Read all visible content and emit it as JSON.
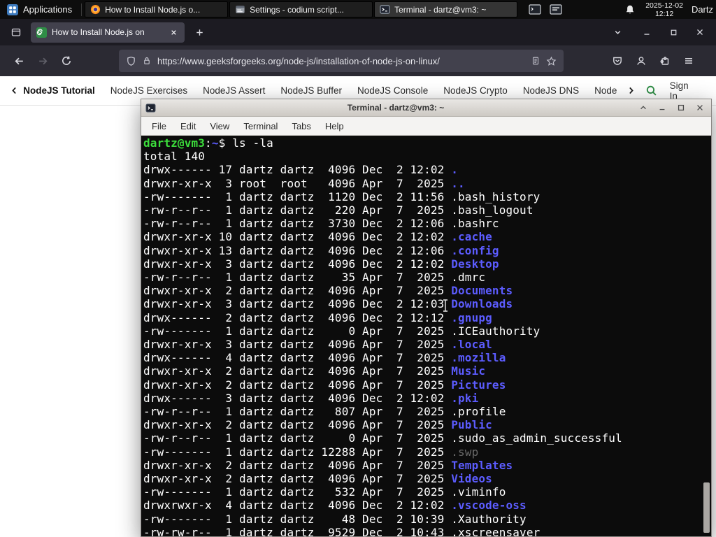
{
  "panel": {
    "applications_label": "Applications",
    "tasks": [
      {
        "label": "How to Install Node.js o...",
        "icon": "firefox-icon"
      },
      {
        "label": "Settings - codium script...",
        "icon": "settings-icon"
      },
      {
        "label": "Terminal - dartz@vm3: ~",
        "icon": "terminal-icon"
      }
    ],
    "tray_icons": [
      "vm-window-icon",
      "terminal-window-icon"
    ],
    "clock": {
      "date": "2025-12-02",
      "time": "12:12"
    },
    "user": "Dartz"
  },
  "browser": {
    "tab": {
      "title": "How to Install Node.js on"
    },
    "url": "https://www.geeksforgeeks.org/node-js/installation-of-node-js-on-linux/",
    "accent_green": "#2f8d46",
    "site_nav": {
      "items": [
        "NodeJS Tutorial",
        "NodeJS Exercises",
        "NodeJS Assert",
        "NodeJS Buffer",
        "NodeJS Console",
        "NodeJS Crypto",
        "NodeJS DNS",
        "Node"
      ],
      "sign_in_label": "Sign In"
    },
    "icons": [
      "firefox-view-icon",
      "site-favicon",
      "close-icon",
      "new-tab-icon",
      "list-tabs-chevron-icon",
      "minimize-icon",
      "maximize-icon",
      "back-icon",
      "forward-icon",
      "reload-icon",
      "shield-icon",
      "lock-icon",
      "reader-view-icon",
      "bookmark-star-icon",
      "pocket-icon",
      "account-icon",
      "extensions-icon",
      "menu-icon",
      "search-icon",
      "chevron-left-icon",
      "chevron-right-icon"
    ]
  },
  "terminal": {
    "title": "Terminal - dartz@vm3: ~",
    "menu_items": [
      "File",
      "Edit",
      "View",
      "Terminal",
      "Tabs",
      "Help"
    ],
    "prompt": {
      "user_host": "dartz@vm3",
      "colon": ":",
      "path": "~",
      "suffix": "$ ",
      "command": "ls -la"
    },
    "total_line": "total 140",
    "colors": {
      "background": "#0c0c0c",
      "foreground": "#ffffff",
      "directory": "#5c5cff",
      "prompt": "#3cdd3c",
      "dim": "#6a6a6a"
    },
    "listing": [
      {
        "meta": "drwx------ 17 dartz dartz  4096 Dec  2 12:02 ",
        "name": ".",
        "type": "dir"
      },
      {
        "meta": "drwxr-xr-x  3 root  root   4096 Apr  7  2025 ",
        "name": "..",
        "type": "dir"
      },
      {
        "meta": "-rw-------  1 dartz dartz  1120 Dec  2 11:56 ",
        "name": ".bash_history",
        "type": "file"
      },
      {
        "meta": "-rw-r--r--  1 dartz dartz   220 Apr  7  2025 ",
        "name": ".bash_logout",
        "type": "file"
      },
      {
        "meta": "-rw-r--r--  1 dartz dartz  3730 Dec  2 12:06 ",
        "name": ".bashrc",
        "type": "file"
      },
      {
        "meta": "drwxr-xr-x 10 dartz dartz  4096 Dec  2 12:02 ",
        "name": ".cache",
        "type": "dir"
      },
      {
        "meta": "drwxr-xr-x 13 dartz dartz  4096 Dec  2 12:06 ",
        "name": ".config",
        "type": "dir"
      },
      {
        "meta": "drwxr-xr-x  3 dartz dartz  4096 Dec  2 12:02 ",
        "name": "Desktop",
        "type": "dir"
      },
      {
        "meta": "-rw-r--r--  1 dartz dartz    35 Apr  7  2025 ",
        "name": ".dmrc",
        "type": "file"
      },
      {
        "meta": "drwxr-xr-x  2 dartz dartz  4096 Apr  7  2025 ",
        "name": "Documents",
        "type": "dir"
      },
      {
        "meta": "drwxr-xr-x  3 dartz dartz  4096 Dec  2 12:03 ",
        "name": "Downloads",
        "type": "dir"
      },
      {
        "meta": "drwx------  2 dartz dartz  4096 Dec  2 12:12 ",
        "name": ".gnupg",
        "type": "dir"
      },
      {
        "meta": "-rw-------  1 dartz dartz     0 Apr  7  2025 ",
        "name": ".ICEauthority",
        "type": "file"
      },
      {
        "meta": "drwxr-xr-x  3 dartz dartz  4096 Apr  7  2025 ",
        "name": ".local",
        "type": "dir"
      },
      {
        "meta": "drwx------  4 dartz dartz  4096 Apr  7  2025 ",
        "name": ".mozilla",
        "type": "dir"
      },
      {
        "meta": "drwxr-xr-x  2 dartz dartz  4096 Apr  7  2025 ",
        "name": "Music",
        "type": "dir"
      },
      {
        "meta": "drwxr-xr-x  2 dartz dartz  4096 Apr  7  2025 ",
        "name": "Pictures",
        "type": "dir"
      },
      {
        "meta": "drwx------  3 dartz dartz  4096 Dec  2 12:02 ",
        "name": ".pki",
        "type": "dir"
      },
      {
        "meta": "-rw-r--r--  1 dartz dartz   807 Apr  7  2025 ",
        "name": ".profile",
        "type": "file"
      },
      {
        "meta": "drwxr-xr-x  2 dartz dartz  4096 Apr  7  2025 ",
        "name": "Public",
        "type": "dir"
      },
      {
        "meta": "-rw-r--r--  1 dartz dartz     0 Apr  7  2025 ",
        "name": ".sudo_as_admin_successful",
        "type": "file"
      },
      {
        "meta": "-rw-------  1 dartz dartz 12288 Apr  7  2025 ",
        "name": ".swp",
        "type": "dim"
      },
      {
        "meta": "drwxr-xr-x  2 dartz dartz  4096 Apr  7  2025 ",
        "name": "Templates",
        "type": "dir"
      },
      {
        "meta": "drwxr-xr-x  2 dartz dartz  4096 Apr  7  2025 ",
        "name": "Videos",
        "type": "dir"
      },
      {
        "meta": "-rw-------  1 dartz dartz   532 Apr  7  2025 ",
        "name": ".viminfo",
        "type": "file"
      },
      {
        "meta": "drwxrwxr-x  4 dartz dartz  4096 Dec  2 12:02 ",
        "name": ".vscode-oss",
        "type": "dir"
      },
      {
        "meta": "-rw-------  1 dartz dartz    48 Dec  2 10:39 ",
        "name": ".Xauthority",
        "type": "file"
      },
      {
        "meta": "-rw-rw-r--  1 dartz dartz  9529 Dec  2 10:43 ",
        "name": ".xscreensaver",
        "type": "file"
      }
    ]
  }
}
